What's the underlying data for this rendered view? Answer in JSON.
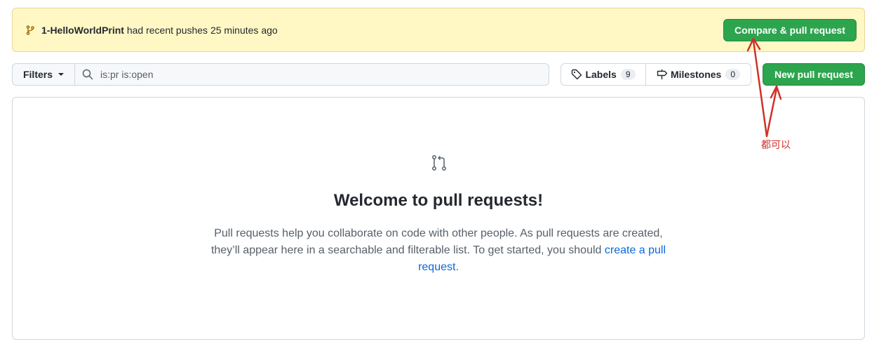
{
  "banner": {
    "branch_name": "1-HelloWorldPrint",
    "message": " had recent pushes 25 minutes ago",
    "compare_button": "Compare & pull request",
    "branch_icon": "git-branch-icon"
  },
  "toolbar": {
    "filters_label": "Filters",
    "search_value": "is:pr is:open",
    "labels_label": "Labels",
    "labels_count": "9",
    "milestones_label": "Milestones",
    "milestones_count": "0",
    "new_pr_button": "New pull request"
  },
  "blankslate": {
    "icon": "git-pull-request-icon",
    "title": "Welcome to pull requests!",
    "desc_part1": "Pull requests help you collaborate on code with other people. As pull requests are created, they’ll appear here in a searchable and filterable list. To get started, you should ",
    "desc_link": "create a pull request",
    "desc_part2": "."
  },
  "annotation": {
    "text": "都可以",
    "color": "#d0302a"
  },
  "colors": {
    "accent_green": "#2da44e",
    "banner_bg": "#fff8c5",
    "link_blue": "#0969da"
  }
}
